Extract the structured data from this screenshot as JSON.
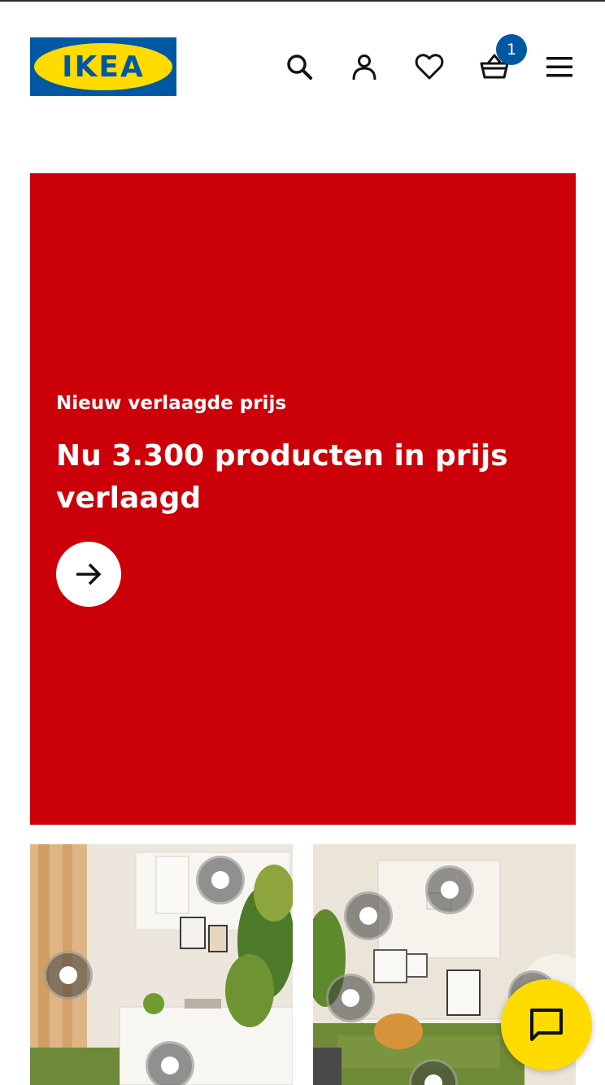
{
  "header": {
    "logo_text": "IKEA",
    "logo_reg": "®",
    "icons": [
      "search-icon",
      "account-icon",
      "heart-icon",
      "basket-icon",
      "menu-icon"
    ],
    "cart_count": "1"
  },
  "hero": {
    "kicker": "Nieuw verlaagde prijs",
    "headline": "Nu 3.300 producten in prijs verlaagd",
    "background_color": "#cc0008",
    "cta_icon": "arrow-right-icon"
  },
  "tiles": [
    {
      "scene": "living room with white wall cabinets and plants",
      "hotspots": 3
    },
    {
      "scene": "living room with green sofa and shelving",
      "hotspots": 5
    }
  ],
  "chat": {
    "icon": "chat-icon",
    "color": "#ffdb00"
  },
  "colors": {
    "brand_blue": "#0058a3",
    "brand_yellow": "#ffdb00"
  }
}
